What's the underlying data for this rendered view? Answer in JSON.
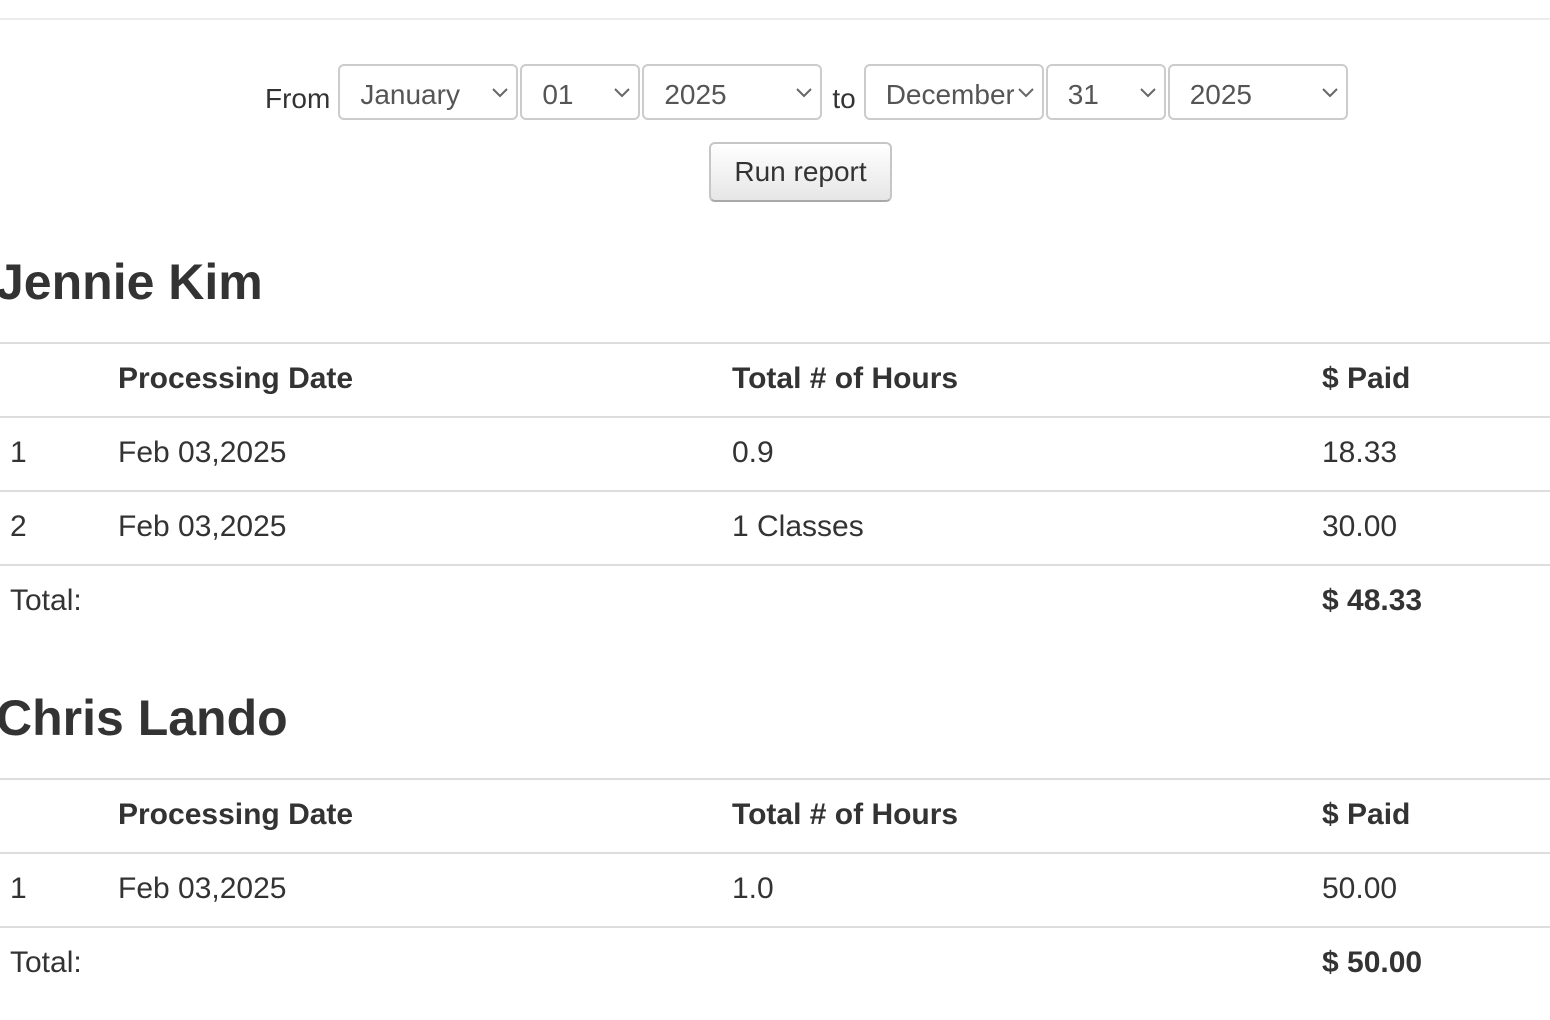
{
  "filters": {
    "from_label": "From",
    "to_label": "to",
    "from_month": "January",
    "from_day": "01",
    "from_year": "2025",
    "to_month": "December",
    "to_day": "31",
    "to_year": "2025",
    "run_label": "Run report"
  },
  "reports": [
    {
      "name": "Jennie Kim",
      "headers": {
        "num": "",
        "date": "Processing Date",
        "hours": "Total # of Hours",
        "paid": "$ Paid"
      },
      "rows": [
        {
          "num": "1",
          "date": "Feb 03,2025",
          "hours": "0.9",
          "paid": "18.33"
        },
        {
          "num": "2",
          "date": "Feb 03,2025",
          "hours": "1 Classes",
          "paid": "30.00"
        }
      ],
      "total_label": "Total:",
      "total_value": "$ 48.33"
    },
    {
      "name": "Chris Lando",
      "headers": {
        "num": "",
        "date": "Processing Date",
        "hours": "Total # of Hours",
        "paid": "$ Paid"
      },
      "rows": [
        {
          "num": "1",
          "date": "Feb 03,2025",
          "hours": "1.0",
          "paid": "50.00"
        }
      ],
      "total_label": "Total:",
      "total_value": "$ 50.00"
    }
  ]
}
